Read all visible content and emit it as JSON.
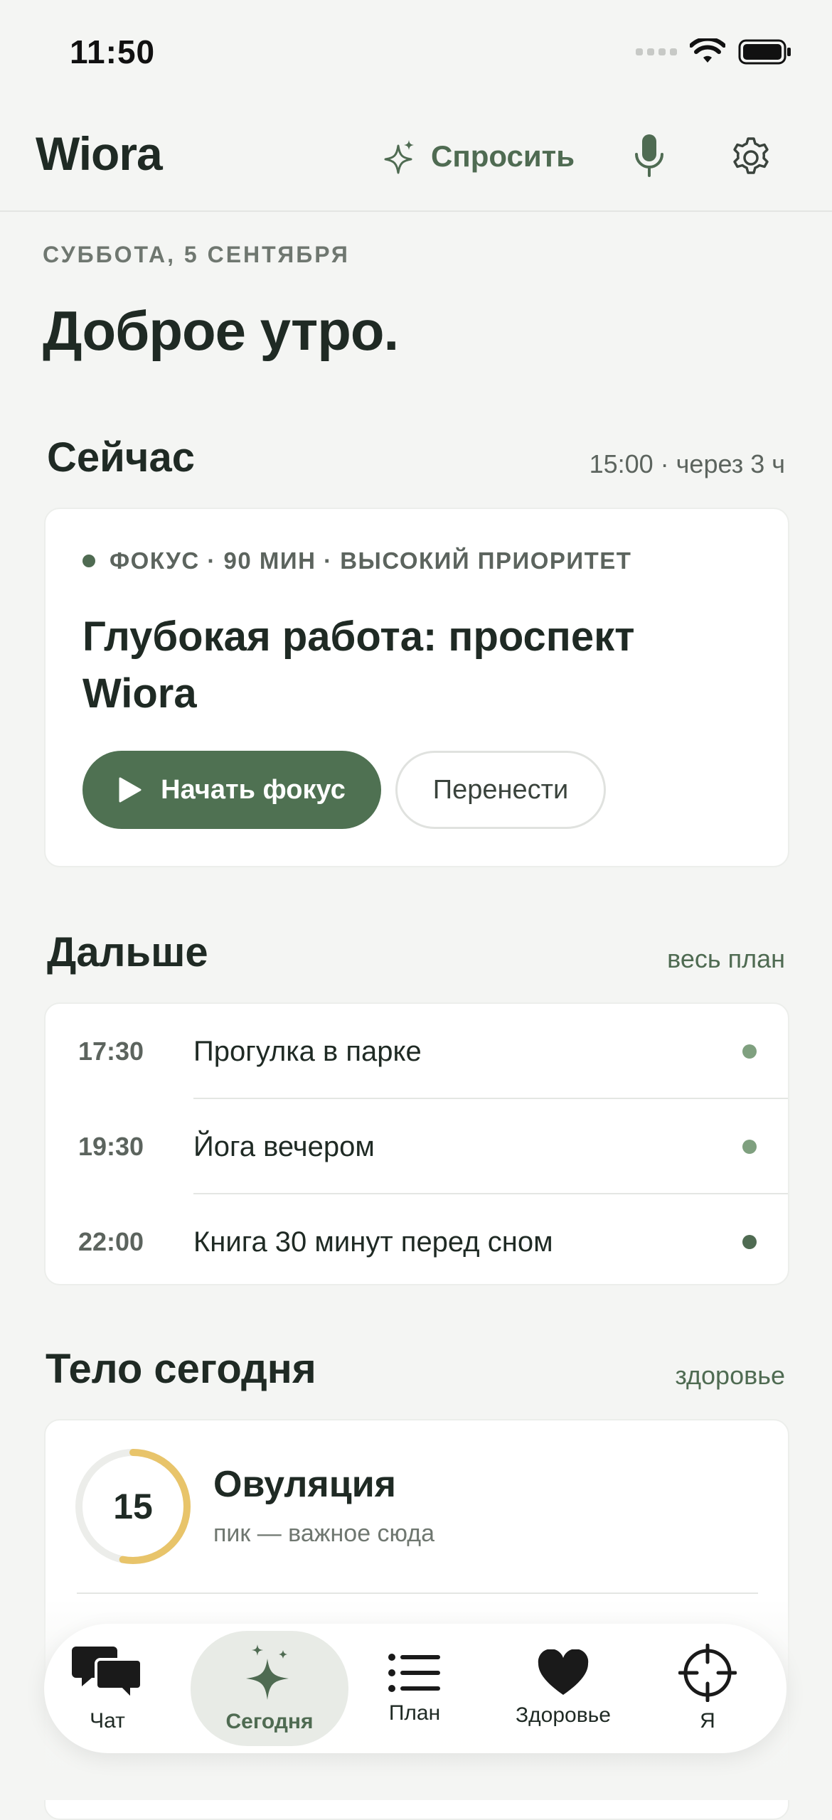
{
  "status": {
    "time": "11:50"
  },
  "header": {
    "title": "Wiora",
    "ask_label": "Спросить"
  },
  "date_line": "СУББОТА, 5 СЕНТЯБРЯ",
  "greeting": "Доброе утро.",
  "now": {
    "section_title": "Сейчас",
    "meta": "15:00 · через 3 ч",
    "tags": "ФОКУС · 90 МИН · ВЫСОКИЙ ПРИОРИТЕТ",
    "task_title": "Глубокая работа: проспект Wiora",
    "start_label": "Начать фокус",
    "move_label": "Перенести"
  },
  "next": {
    "section_title": "Дальше",
    "link": "весь план",
    "items": [
      {
        "time": "17:30",
        "text": "Прогулка в парке",
        "dot_color": "#7fa07f"
      },
      {
        "time": "19:30",
        "text": "Йога вечером",
        "dot_color": "#7fa07f"
      },
      {
        "time": "22:00",
        "text": "Книга 30 минут перед сном",
        "dot_color": "#4f6b52"
      }
    ]
  },
  "body": {
    "section_title": "Тело сегодня",
    "link": "здоровье",
    "cycle_day": "15",
    "cycle_progress": 0.53,
    "phase_title": "Овуляция",
    "phase_sub": "пик — важное сюда",
    "ring_color": "#e8c46a"
  },
  "tabs": [
    {
      "label": "Чат",
      "icon": "chat-bubbles-icon"
    },
    {
      "label": "Сегодня",
      "icon": "sparkle-icon",
      "active": true
    },
    {
      "label": "План",
      "icon": "list-icon"
    },
    {
      "label": "Здоровье",
      "icon": "heart-icon"
    },
    {
      "label": "Я",
      "icon": "target-icon"
    }
  ],
  "colors": {
    "accent": "#4f7152",
    "background": "#f4f5f3"
  }
}
